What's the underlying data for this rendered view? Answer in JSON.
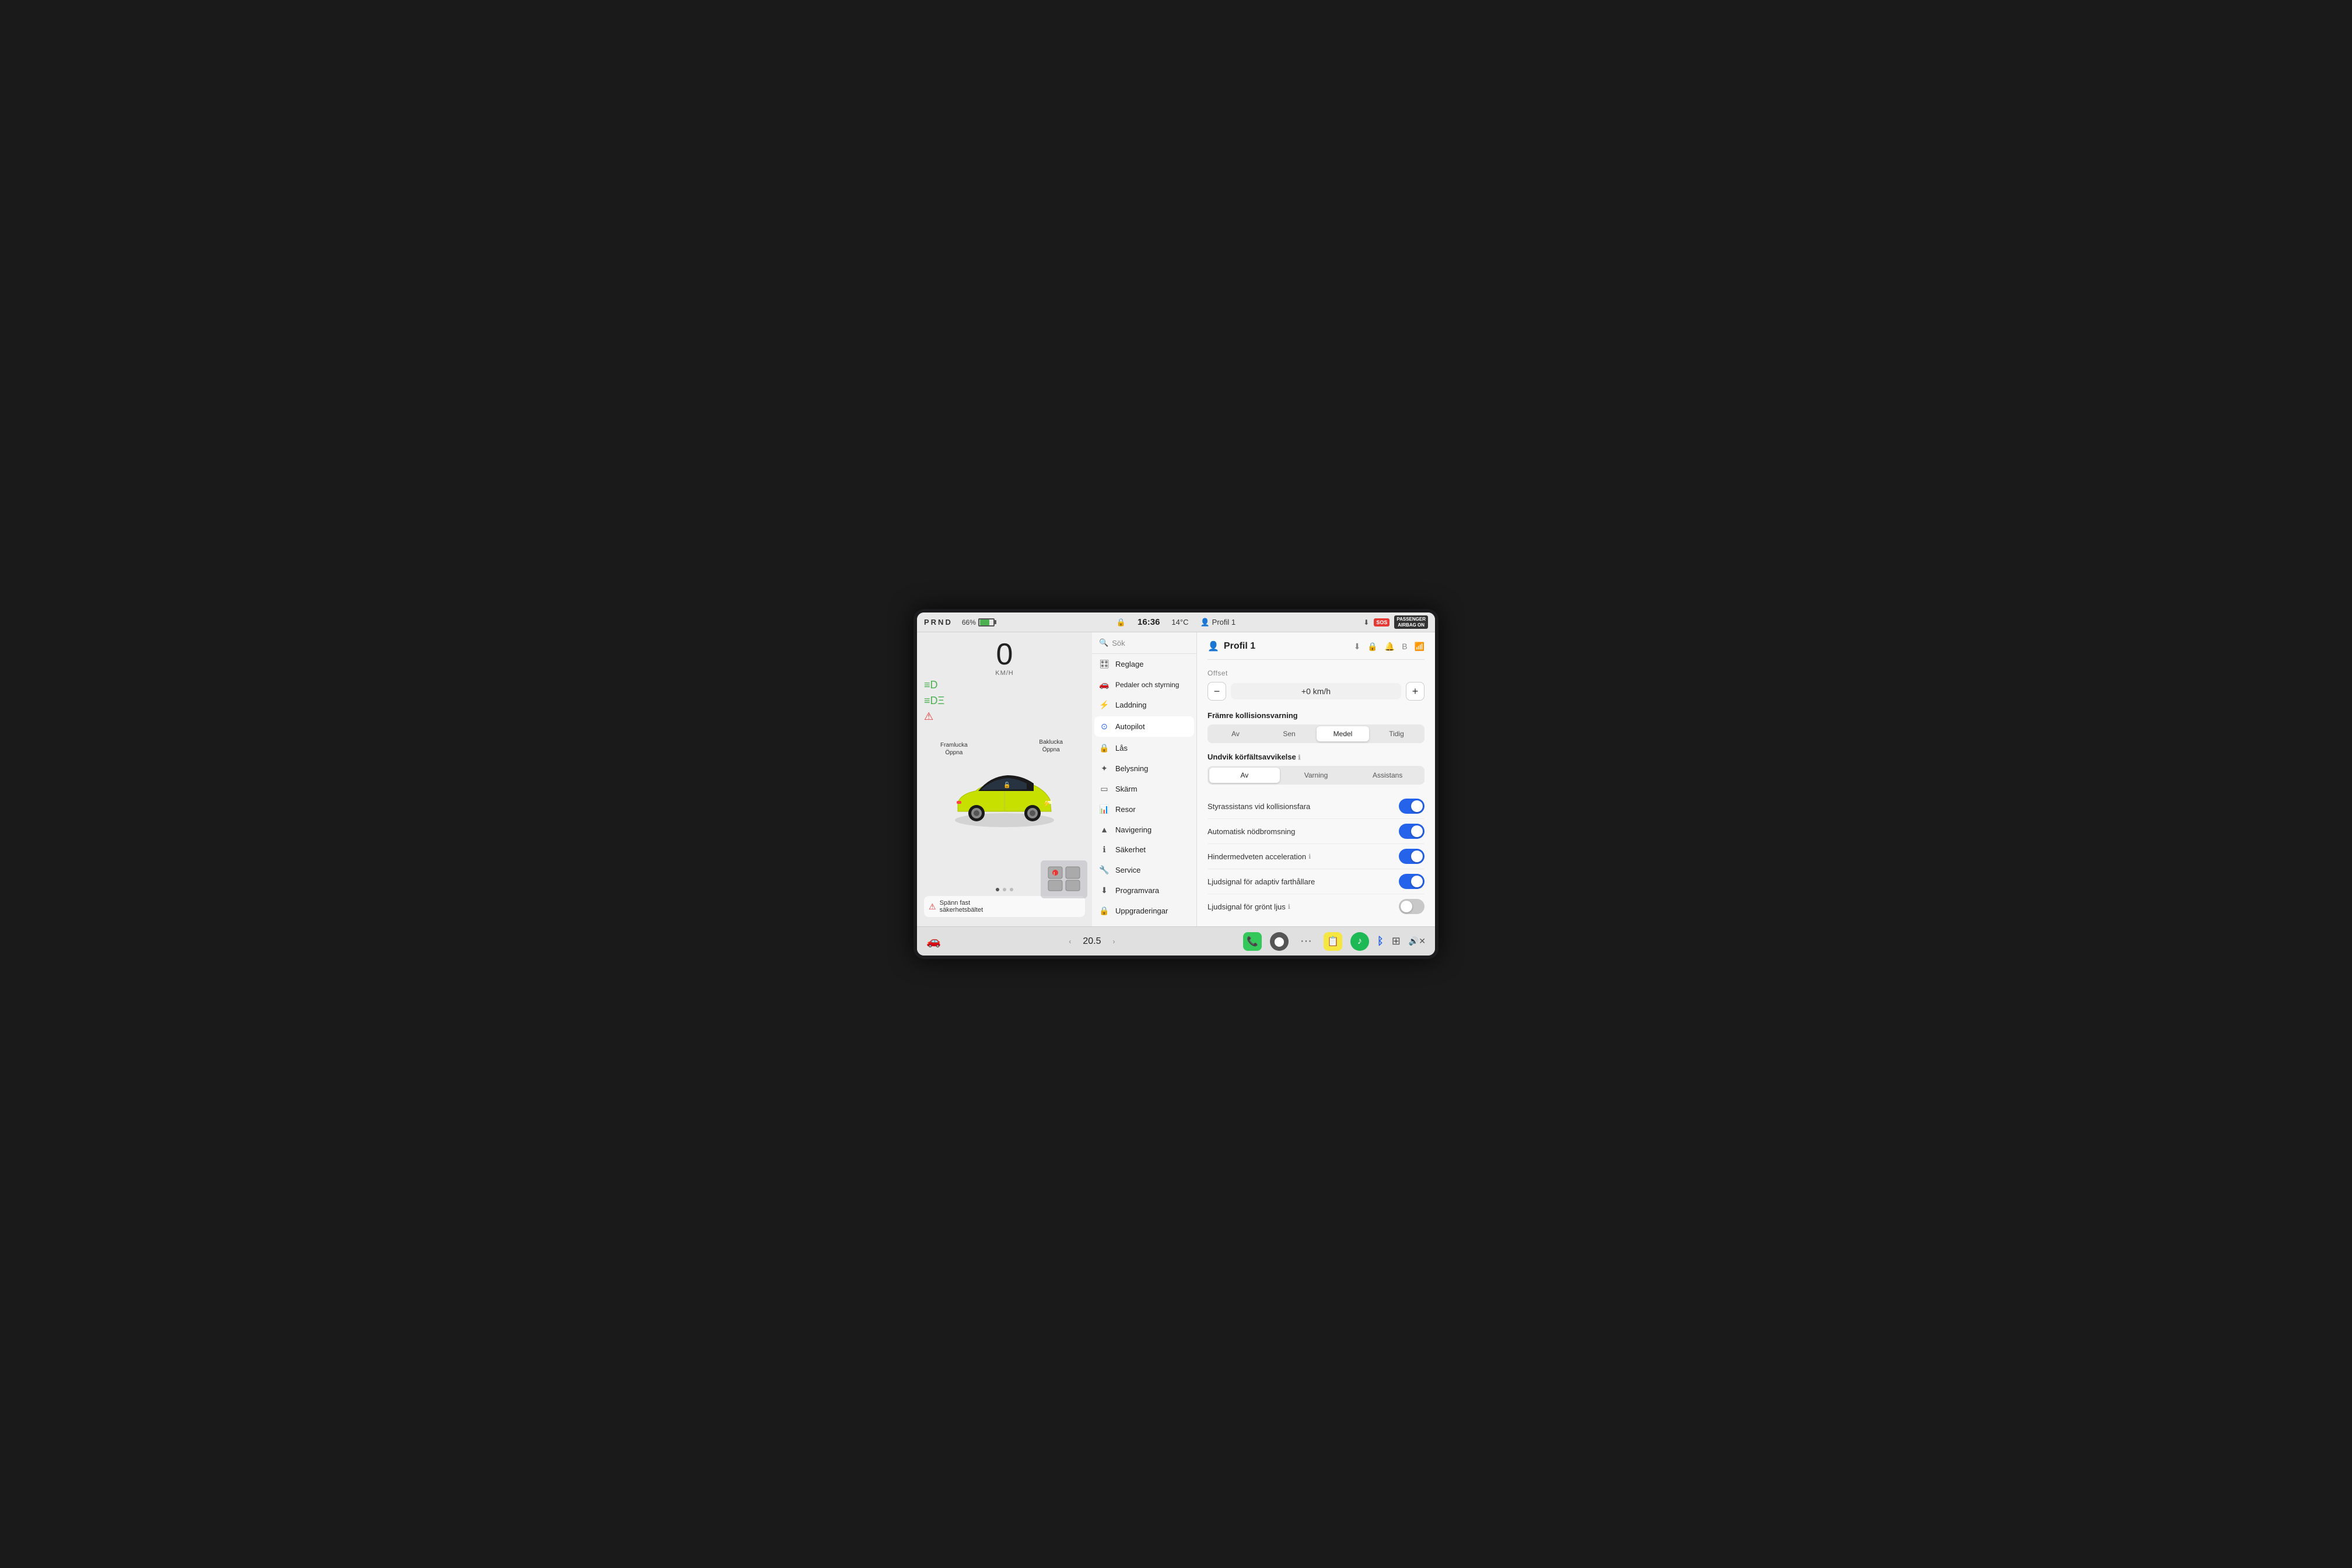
{
  "status_bar": {
    "prnd": "PRND",
    "battery_percent": "66%",
    "lock_icon": "🔒",
    "time": "16:36",
    "temperature": "14°C",
    "profile_label": "Profil 1",
    "sos_label": "SOS",
    "airbag_label": "PASSENGER\nAIRBAG ON"
  },
  "left_panel": {
    "speed": "0",
    "speed_unit": "KM/H",
    "car_label_front": "Framlucka\nÖppna",
    "car_label_rear": "Baklucka\nÖppna",
    "seatbelt_warning": "Spänn fast\nsäkerhetsbältet",
    "page_dots": [
      true,
      false,
      false
    ]
  },
  "menu": {
    "search_placeholder": "Sök",
    "items": [
      {
        "id": "reglage",
        "icon": "🎛",
        "label": "Reglage",
        "active": false
      },
      {
        "id": "pedaler",
        "icon": "🚗",
        "label": "Pedaler och\nstyrning",
        "active": false
      },
      {
        "id": "laddning",
        "icon": "⚡",
        "label": "Laddning",
        "active": false
      },
      {
        "id": "autopilot",
        "icon": "🔵",
        "label": "Autopilot",
        "active": true
      },
      {
        "id": "las",
        "icon": "🔒",
        "label": "Lås",
        "active": false
      },
      {
        "id": "belysning",
        "icon": "☀",
        "label": "Belysning",
        "active": false
      },
      {
        "id": "skarm",
        "icon": "⬜",
        "label": "Skärm",
        "active": false
      },
      {
        "id": "resor",
        "icon": "📊",
        "label": "Resor",
        "active": false
      },
      {
        "id": "navigering",
        "icon": "▲",
        "label": "Navigering",
        "active": false
      },
      {
        "id": "sakerhet",
        "icon": "ℹ",
        "label": "Säkerhet",
        "active": false
      },
      {
        "id": "service",
        "icon": "🔧",
        "label": "Service",
        "active": false
      },
      {
        "id": "programvara",
        "icon": "⬇",
        "label": "Programvara",
        "active": false
      },
      {
        "id": "uppgraderingar",
        "icon": "🔒",
        "label": "Uppgraderingar",
        "active": false
      }
    ]
  },
  "settings": {
    "profile_name": "Profil 1",
    "offset_label": "Offset",
    "offset_value": "+0 km/h",
    "collision_warning_label": "Främre kollisionsvarning",
    "collision_options": [
      "Av",
      "Sen",
      "Medel",
      "Tidig"
    ],
    "collision_active": "Medel",
    "lane_departure_label": "Undvik körfältsavvikelse",
    "lane_options": [
      "Av",
      "Varning",
      "Assistans"
    ],
    "lane_active": "Av",
    "toggles": [
      {
        "label": "Styrassistans vid kollisionsfara",
        "on": true,
        "info": false
      },
      {
        "label": "Automatisk nödbromsning",
        "on": true,
        "info": false
      },
      {
        "label": "Hindermedveten acceleration",
        "on": true,
        "info": true
      },
      {
        "label": "Ljudsignal för adaptiv farthållare",
        "on": true,
        "info": false
      },
      {
        "label": "Ljudsignal för grönt ljus",
        "on": false,
        "info": true
      }
    ]
  },
  "bottom_bar": {
    "temperature": "20.5",
    "phone_icon": "📞",
    "media_icon": "⬤",
    "dots_icon": "···",
    "notes_icon": "📋",
    "spotify_icon": "♪",
    "bt_icon": "B",
    "camera_icon": "⬛",
    "volume_icon": "🔊"
  }
}
